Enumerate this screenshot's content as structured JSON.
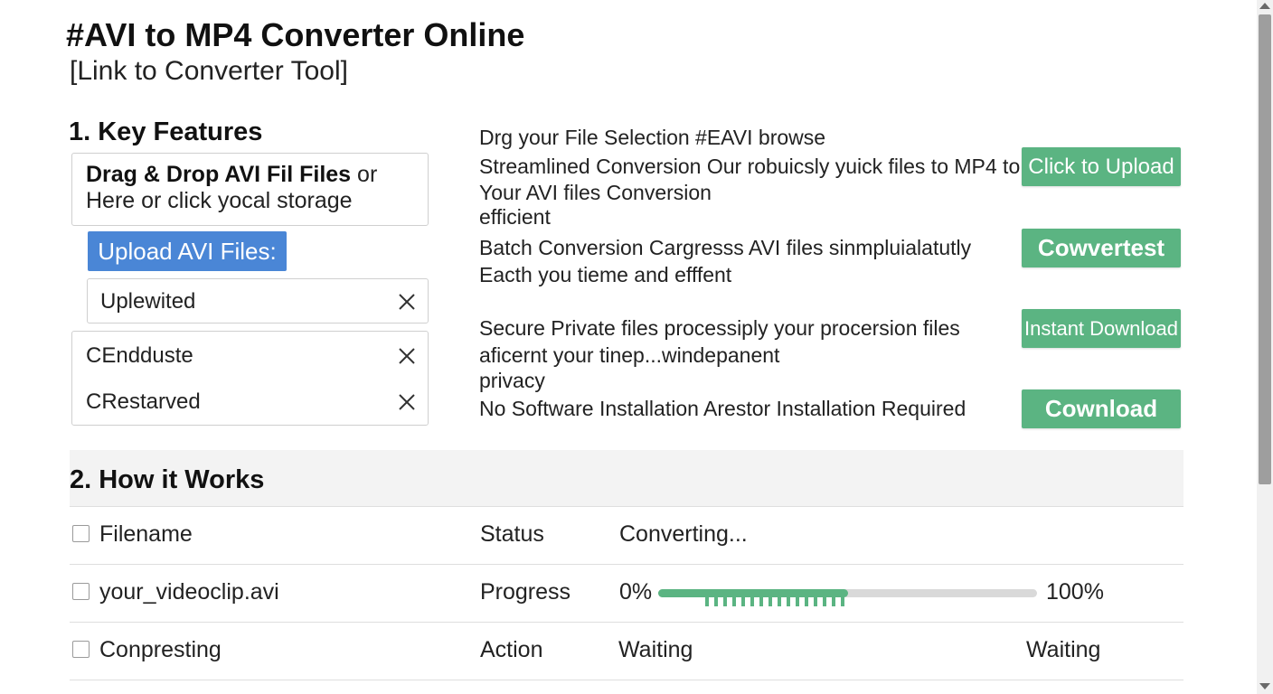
{
  "page": {
    "title": "#AVI to MP4 Converter Online",
    "subtitle": "[Link to Converter Tool]"
  },
  "key_features": {
    "heading": "1. Key Features",
    "dropzone": {
      "bold_text": "Drag & Drop AVI Fil Files",
      "or_text": "or",
      "line2": "Here or click  yocal storage"
    },
    "upload_button": "Upload AVI Files:",
    "files": [
      {
        "name": "Uplewited"
      },
      {
        "name": "CEndduste"
      },
      {
        "name": "CRestarved"
      }
    ]
  },
  "features": [
    {
      "lines": [
        "Drg your File Selection    #EAVI browse"
      ]
    },
    {
      "lines": [
        "Streamlined Conversion Our robuicsly yuick files to MP4 to",
        "Your AVI files Conversion",
        "efficient"
      ]
    },
    {
      "lines": [
        "Batch Conversion Cargresss    AVI files sinmpluialatutly",
        "Eacth you tieme and efffent"
      ]
    },
    {
      "lines": [
        "Secure Private files processiply your  procersion files",
        "aficernt your tinep...windepanent",
        "privacy"
      ]
    },
    {
      "lines": [
        "No Software Installation Arestor Installation Required"
      ]
    }
  ],
  "action_buttons": [
    {
      "label": "Click to Upload"
    },
    {
      "label": "Cowvertest"
    },
    {
      "label": "Instant Download"
    },
    {
      "label": "Cownload"
    }
  ],
  "how_it_works": {
    "heading": "2. How it Works",
    "rows": [
      {
        "col1": "Filename",
        "col2": "Status",
        "col3": "Converting...",
        "col4": ""
      },
      {
        "col1": "your_videoclip.avi",
        "col2": "Progress",
        "col3": "0%",
        "col4": "100%"
      },
      {
        "col1": "Conpresting",
        "col2": "Action",
        "col3": "Waiting",
        "col4": "Waiting"
      }
    ],
    "progress_fraction": 0.5
  },
  "colors": {
    "accent_blue": "#4a86d6",
    "accent_green": "#5bb482"
  }
}
